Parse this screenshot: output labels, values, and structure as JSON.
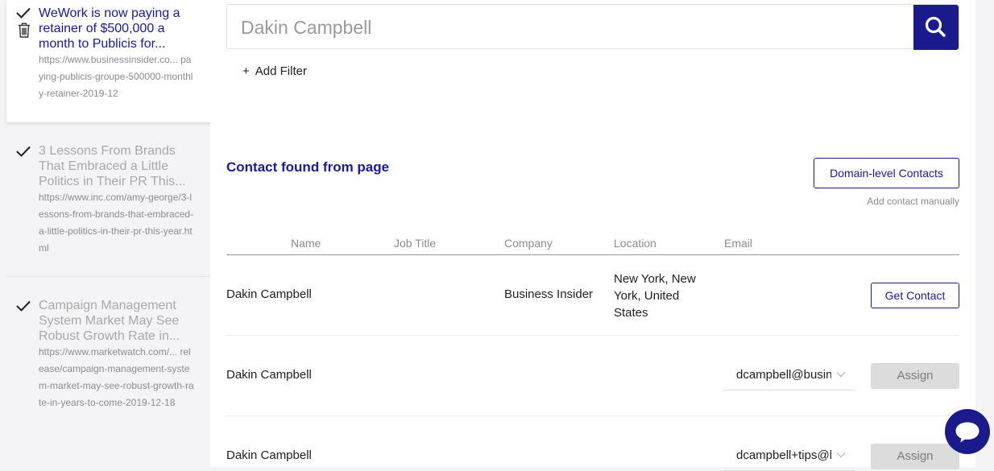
{
  "sidebar": {
    "articles": [
      {
        "title": "WeWork is now paying a retainer of $500,000 a month to Publicis for...",
        "url": "https://www.businessinsider.co... paying-publicis-groupe-500000-monthly-retainer-2019-12"
      },
      {
        "title": "3 Lessons From Brands That Embraced a Little Politics in Their PR This...",
        "url": "https://www.inc.com/amy-george/3-lessons-from-brands-that-embraced-a-little-politics-in-their-pr-this-year.html"
      },
      {
        "title": "Campaign Management System Market May See Robust Growth Rate in...",
        "url": "https://www.marketwatch.com/... release/campaign-management-system-market-may-see-robust-growth-rate-in-years-to-come-2019-12-18"
      }
    ]
  },
  "search": {
    "placeholder": "Dakin Campbell",
    "add_filter_label": "Add Filter",
    "add_filter_plus": "+"
  },
  "contacts": {
    "section_title": "Contact found from page",
    "domain_button": "Domain-level Contacts",
    "add_manual": "Add contact manually",
    "columns": [
      "Name",
      "Job Title",
      "Company",
      "Location",
      "Email"
    ],
    "rows": [
      {
        "name": "Dakin Campbell",
        "company": "Business Insider",
        "location": "New York, New York, United States",
        "action": "Get Contact"
      },
      {
        "name": "Dakin Campbell",
        "email": "dcampbell@businessinsider.com",
        "action": "Assign"
      },
      {
        "name": "Dakin Campbell",
        "email": "dcampbell+tips@businessinsider.com",
        "action": "Assign"
      }
    ]
  },
  "colors": {
    "accent": "#1a1a8c",
    "link": "#1a1a9e",
    "muted_text": "#a8a8a8",
    "disabled_button": "#dcdcdc"
  },
  "icons": {
    "check": "check-icon",
    "trash": "trash-icon",
    "search": "search-icon",
    "chevron": "chevron-down-icon",
    "chat": "chat-icon"
  }
}
